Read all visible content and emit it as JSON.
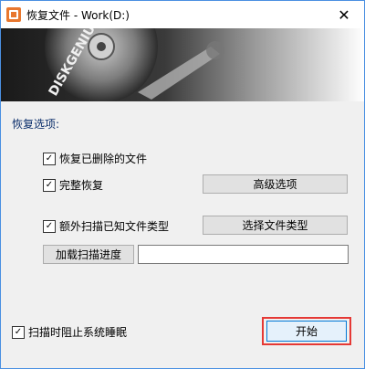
{
  "window": {
    "title": "恢复文件 - Work(D:)",
    "close_glyph": "✕"
  },
  "banner": {
    "brand": "DISKGENIUS"
  },
  "options": {
    "section_label": "恢复选项:",
    "recover_deleted": {
      "label": "恢复已删除的文件",
      "checked": true
    },
    "full_recovery": {
      "label": "完整恢复",
      "checked": true
    },
    "extra_scan": {
      "label": "额外扫描已知文件类型",
      "checked": true
    },
    "advanced_label": "高级选项",
    "select_types_label": "选择文件类型",
    "load_progress_label": "加载扫描进度",
    "progress_path_value": ""
  },
  "footer": {
    "prevent_sleep": {
      "label": "扫描时阻止系统睡眠",
      "checked": true
    },
    "start_label": "开始"
  },
  "colors": {
    "accent_border": "#4a90e2",
    "highlight": "#e53935",
    "section_text": "#0b2e6b"
  },
  "icons": {
    "app": "diskgenius-app-icon",
    "check": "✓"
  }
}
